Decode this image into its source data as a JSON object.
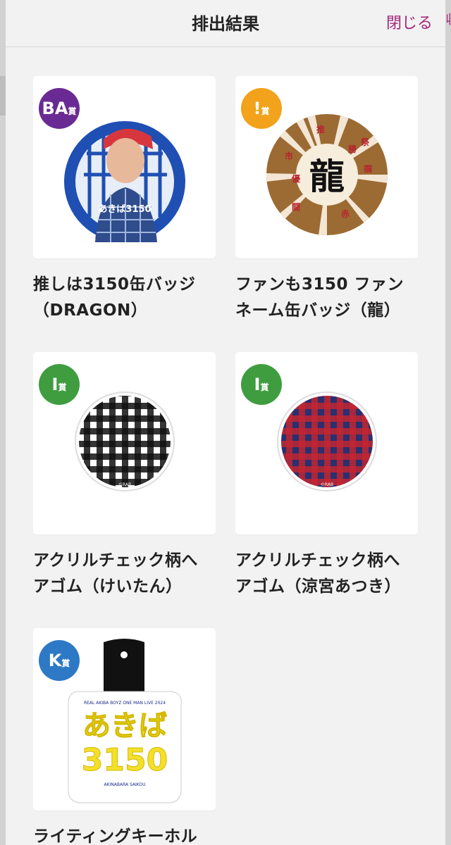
{
  "header": {
    "title": "排出結果",
    "close_label": "閉じる"
  },
  "right_edge_fragment": "収",
  "items": [
    {
      "rank": "BA",
      "rank_suffix": "賞",
      "badge_color": "#6a2a93",
      "name_line1": "推しは3150缶バッジ",
      "name_line2": "（DRAGON）",
      "image": {
        "type": "badge-photo",
        "background_color": "#1f4fb3",
        "caption": "あきば3150"
      }
    },
    {
      "rank": "!",
      "rank_suffix": "賞",
      "badge_color": "#f2a21b",
      "name_line1": "ファンも3150 ファン",
      "name_line2": "ネーム缶バッジ（龍）",
      "image": {
        "type": "badge-text",
        "background_color": "#9c6b33",
        "main_text": "龍",
        "chars": [
          "推",
          "優",
          "勝",
          "祭",
          "掴",
          "闘",
          "赤",
          "市"
        ]
      }
    },
    {
      "rank": "I",
      "rank_suffix": "賞",
      "badge_color": "#3f9d3f",
      "name_line1": "アクリルチェック柄へ",
      "name_line2": "アゴム（けいたん）",
      "image": {
        "type": "check-pattern",
        "color_a": "#111111",
        "color_b": "#ffffff",
        "mark": "©RAB"
      }
    },
    {
      "rank": "I",
      "rank_suffix": "賞",
      "badge_color": "#3f9d3f",
      "name_line1": "アクリルチェック柄へ",
      "name_line2": "アゴム（涼宮あつき）",
      "image": {
        "type": "check-pattern",
        "color_a": "#c6262f",
        "color_b": "#2b2f6e",
        "mark": "©RAB"
      }
    },
    {
      "rank": "K",
      "rank_suffix": "賞",
      "badge_color": "#2d79c6",
      "name_line1": "ライティングキーホル",
      "name_line2": "",
      "image": {
        "type": "keychain",
        "top_text": "REAL AKIBA BOYZ ONE MAN LIVE 2024",
        "logo_line1": "あきば",
        "logo_line2": "3150",
        "bottom_text": "AKINABARA SAIKOU",
        "yellow": "#f4df2a"
      }
    }
  ]
}
